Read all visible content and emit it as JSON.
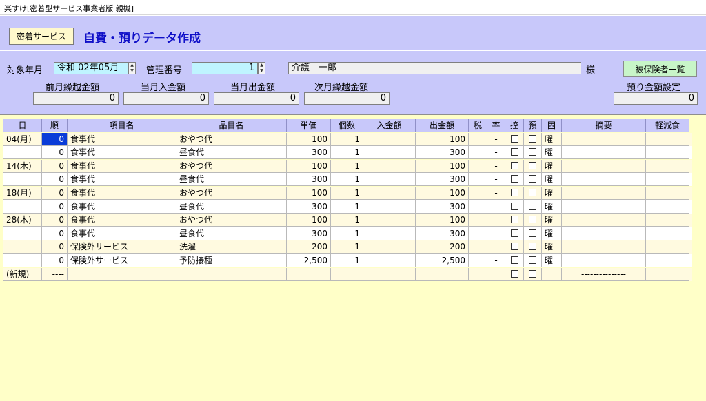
{
  "window": {
    "title": "楽すけ[密着型サービス事業者版 親機]"
  },
  "header": {
    "service_button": "密着サービス",
    "page_title": "自費・預りデータ作成"
  },
  "filters": {
    "target_month_label": "対象年月",
    "target_month_value": "令和 02年05月",
    "mgmt_no_label": "管理番号",
    "mgmt_no_value": "1",
    "person_name": "介護　一郎",
    "honorific": "様",
    "insured_list_button": "被保険者一覧",
    "prev_carry_label": "前月繰越金額",
    "prev_carry_value": "0",
    "month_in_label": "当月入金額",
    "month_in_value": "0",
    "month_out_label": "当月出金額",
    "month_out_value": "0",
    "next_carry_label": "次月繰越金額",
    "next_carry_value": "0",
    "deposit_setting_label": "預り金額設定",
    "deposit_setting_value": "0"
  },
  "table": {
    "columns": [
      "日",
      "順",
      "項目名",
      "品目名",
      "単価",
      "個数",
      "入金額",
      "出金額",
      "税",
      "率",
      "控",
      "預",
      "固",
      "摘要",
      "軽減食"
    ],
    "rows": [
      [
        "04(月)",
        "0",
        "食事代",
        "おやつ代",
        "100",
        "1",
        "",
        "100",
        "",
        "-",
        "",
        "",
        "曜",
        "",
        ""
      ],
      [
        "",
        "0",
        "食事代",
        "昼食代",
        "300",
        "1",
        "",
        "300",
        "",
        "-",
        "",
        "",
        "曜",
        "",
        ""
      ],
      [
        "14(木)",
        "0",
        "食事代",
        "おやつ代",
        "100",
        "1",
        "",
        "100",
        "",
        "-",
        "",
        "",
        "曜",
        "",
        ""
      ],
      [
        "",
        "0",
        "食事代",
        "昼食代",
        "300",
        "1",
        "",
        "300",
        "",
        "-",
        "",
        "",
        "曜",
        "",
        ""
      ],
      [
        "18(月)",
        "0",
        "食事代",
        "おやつ代",
        "100",
        "1",
        "",
        "100",
        "",
        "-",
        "",
        "",
        "曜",
        "",
        ""
      ],
      [
        "",
        "0",
        "食事代",
        "昼食代",
        "300",
        "1",
        "",
        "300",
        "",
        "-",
        "",
        "",
        "曜",
        "",
        ""
      ],
      [
        "28(木)",
        "0",
        "食事代",
        "おやつ代",
        "100",
        "1",
        "",
        "100",
        "",
        "-",
        "",
        "",
        "曜",
        "",
        ""
      ],
      [
        "",
        "0",
        "食事代",
        "昼食代",
        "300",
        "1",
        "",
        "300",
        "",
        "-",
        "",
        "",
        "曜",
        "",
        ""
      ],
      [
        "",
        "0",
        "保険外サービス",
        "洗濯",
        "200",
        "1",
        "",
        "200",
        "",
        "-",
        "",
        "",
        "曜",
        "",
        ""
      ],
      [
        "",
        "0",
        "保険外サービス",
        "予防接種",
        "2,500",
        "1",
        "",
        "2,500",
        "",
        "-",
        "",
        "",
        "曜",
        "",
        ""
      ],
      [
        "(新規)",
        "----",
        "",
        "",
        "",
        "",
        "",
        "",
        "",
        "",
        "",
        "",
        "",
        "---------------",
        ""
      ]
    ]
  }
}
